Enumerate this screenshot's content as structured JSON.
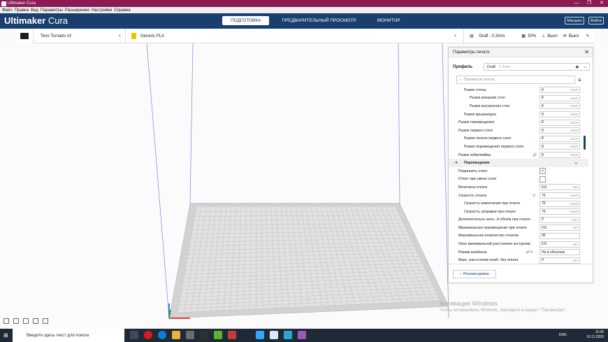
{
  "window": {
    "title": "Ultimaker Cura",
    "controls": [
      "—",
      "❐",
      "✕"
    ]
  },
  "menu": [
    "Файл",
    "Правка",
    "Вид",
    "Параметры",
    "Расширения",
    "Настройки",
    "Справка"
  ],
  "header": {
    "logo_bold": "Ultimaker",
    "logo_light": " Cura",
    "stages": [
      "ПОДГОТОВКА",
      "ПРЕДВАРИТЕЛЬНЫЙ ПРОСМОТР",
      "МОНИТОР"
    ],
    "marketplace": "Магазин",
    "signin": "Войти"
  },
  "toolbar": {
    "printer": "Tevo Tornado #2",
    "material": "Generic PLA",
    "profile": "Draft - 0.3mm",
    "infill": "30%",
    "support": "Выкл",
    "adhesion": "Выкл"
  },
  "panel": {
    "title": "Параметры печати",
    "profile_label": "Профиль",
    "profile_value": "Draft",
    "profile_hint": "0.3mm",
    "search_placeholder": "Параметры поиска",
    "rows": [
      {
        "label": "Рывок стены",
        "indent": 1,
        "value": "8",
        "unit": "mm/s"
      },
      {
        "label": "Рывок внешних стен",
        "indent": 2,
        "value": "8",
        "unit": "mm/s"
      },
      {
        "label": "Рывок внутренних стен",
        "indent": 2,
        "value": "8",
        "unit": "mm/s"
      },
      {
        "label": "Рывок крышки/дна",
        "indent": 1,
        "value": "8",
        "unit": "mm/s"
      },
      {
        "label": "Рывок перемещения",
        "indent": 0,
        "value": "8",
        "unit": "mm/s"
      },
      {
        "label": "Рывок первого слоя",
        "indent": 0,
        "value": "8",
        "unit": "mm/s"
      },
      {
        "label": "Рывок печати первого слоя",
        "indent": 1,
        "value": "8",
        "unit": "mm/s"
      },
      {
        "label": "Рывок перемещения первого слоя",
        "indent": 1,
        "value": "8",
        "unit": "mm/s"
      },
      {
        "label": "Рывок юбки/каймы",
        "indent": 0,
        "value": "8",
        "unit": "mm/s",
        "icon": "link"
      },
      {
        "label": "Перемещение",
        "category": true
      },
      {
        "label": "Разрешить откат",
        "indent": 0,
        "checkbox": true,
        "checked": "✓"
      },
      {
        "label": "Откат при смене слоя",
        "indent": 0,
        "checkbox": true,
        "checked": ""
      },
      {
        "label": "Величина отката",
        "indent": 0,
        "value": "6.8",
        "unit": "mm"
      },
      {
        "label": "Скорость отката",
        "indent": 0,
        "value": "70",
        "unit": "mm/s",
        "icon": "reset"
      },
      {
        "label": "Скорость извлечения при откате",
        "indent": 1,
        "value": "70",
        "unit": "mm/s"
      },
      {
        "label": "Скорость заправки при откате",
        "indent": 1,
        "value": "70",
        "unit": "mm/s"
      },
      {
        "label": "Дополнительно запо...й объём при откате",
        "indent": 0,
        "value": "0",
        "unit": "mm³"
      },
      {
        "label": "Минимальное перемещение при откате",
        "indent": 0,
        "value": "0.8",
        "unit": "mm"
      },
      {
        "label": "Максимальное количество откатов",
        "indent": 0,
        "value": "90",
        "unit": ""
      },
      {
        "label": "Окно минимальной расстояния экструзии",
        "indent": 0,
        "value": "6.8",
        "unit": "mm"
      },
      {
        "label": "Режим комбинга",
        "indent": 0,
        "value": "Не в оболочке",
        "unit": "",
        "icon": "link-reset"
      },
      {
        "label": "Макс. расстояние комб. без отката",
        "indent": 0,
        "value": "0",
        "unit": "mm"
      }
    ],
    "recommended_button": "Рекомендован"
  },
  "activation": {
    "title": "Активация Windows",
    "text": "Чтобы активировать Windows, перейдите в раздел \"Параметры\"."
  },
  "taskbar": {
    "search_placeholder": "Введите здесь текст для поиска",
    "lang": "ENG",
    "time": "11:06",
    "date": "10.11.2020"
  }
}
